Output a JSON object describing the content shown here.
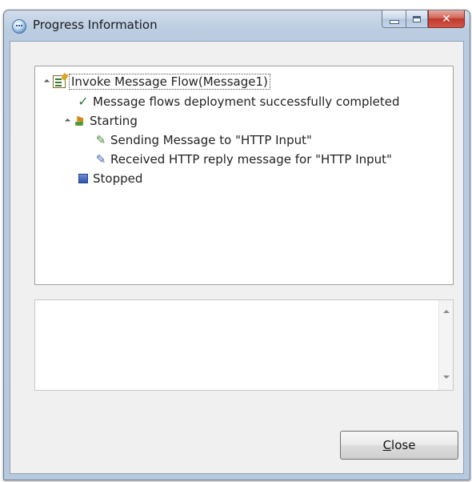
{
  "window": {
    "title": "Progress Information"
  },
  "tree": {
    "items": [
      {
        "label": "Invoke Message Flow(Message1)",
        "icon": "message-flow-icon",
        "level": 0,
        "expanded": true,
        "selected": true
      },
      {
        "label": "Message flows deployment successfully completed",
        "icon": "checkmark-icon",
        "level": 1
      },
      {
        "label": "Starting",
        "icon": "starting-icon",
        "level": 1,
        "expanded": true
      },
      {
        "label": "Sending Message to \"HTTP Input\"",
        "icon": "send-message-icon",
        "level": 2
      },
      {
        "label": "Received HTTP reply message for \"HTTP Input\"",
        "icon": "receive-message-icon",
        "level": 2
      },
      {
        "label": "Stopped",
        "icon": "stopped-icon",
        "level": 1
      }
    ]
  },
  "buttons": {
    "close_mnemonic": "C",
    "close_rest": "lose"
  },
  "colors": {
    "title_bar": "#bccde2",
    "close_caption": "#c0392b",
    "dialog_background": "#f0f0f0"
  }
}
